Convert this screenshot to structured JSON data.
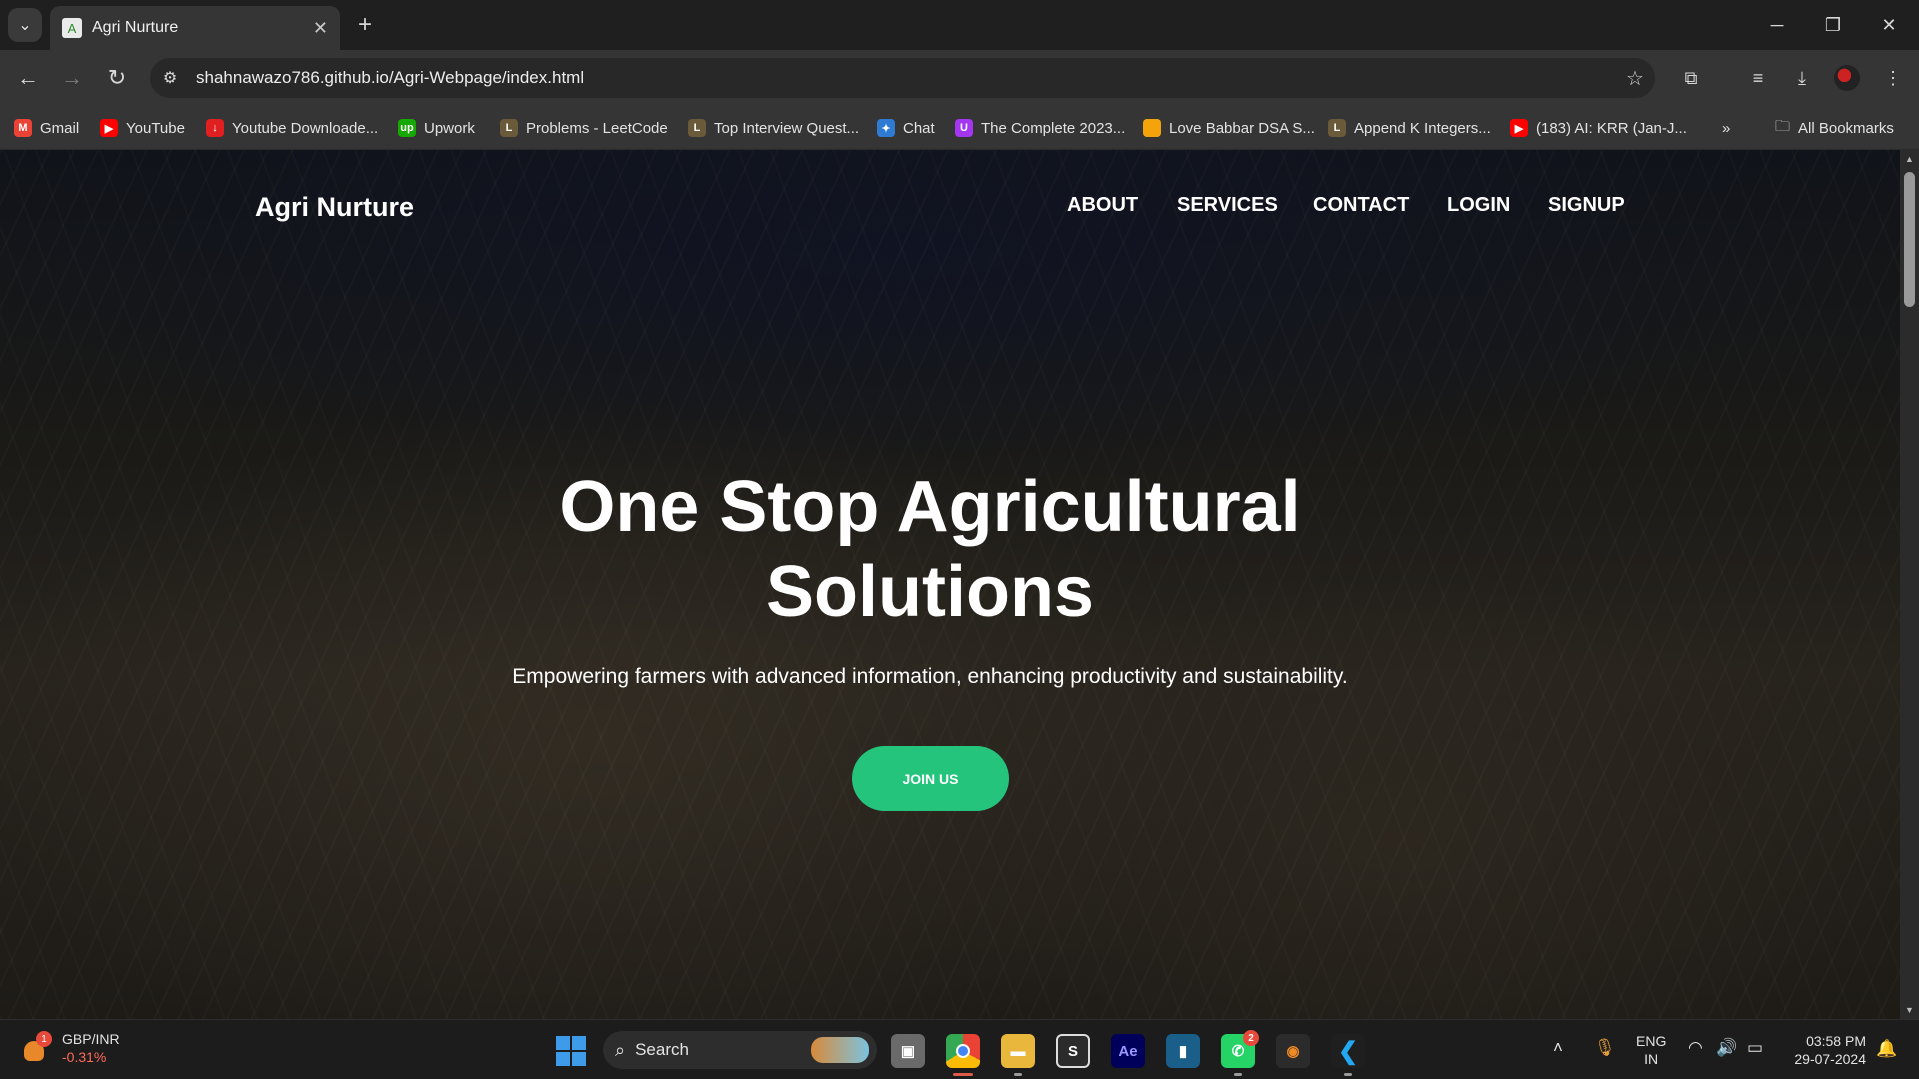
{
  "browser": {
    "tab_title": "Agri Nurture",
    "tab_favicon": "A",
    "url": "shahnawazo786.github.io/Agri-Webpage/index.html",
    "bookmarks": [
      {
        "label": "Gmail",
        "icon": "M",
        "color": "#ea4335"
      },
      {
        "label": "YouTube",
        "icon": "▶",
        "color": "#ff0000"
      },
      {
        "label": "Youtube Downloade...",
        "icon": "↓",
        "color": "#e02020"
      },
      {
        "label": "Upwork",
        "icon": "up",
        "color": "#14a800"
      },
      {
        "label": "Problems - LeetCode",
        "icon": "L",
        "color": "#6b5a3a"
      },
      {
        "label": "Top Interview Quest...",
        "icon": "L",
        "color": "#6b5a3a"
      },
      {
        "label": "Chat",
        "icon": "✦",
        "color": "#2f7bd3"
      },
      {
        "label": "The Complete 2023...",
        "icon": "U",
        "color": "#a435f0"
      },
      {
        "label": "Love Babbar DSA S...",
        "icon": "",
        "color": "#f5a30a"
      },
      {
        "label": "Append K Integers...",
        "icon": "L",
        "color": "#6b5a3a"
      },
      {
        "label": "(183) AI: KRR (Jan-J...",
        "icon": "▶",
        "color": "#ff0000"
      }
    ],
    "bookmarks_overflow": "»",
    "all_bookmarks": "All Bookmarks"
  },
  "site": {
    "logo": "Agri Nurture",
    "nav": [
      "ABOUT",
      "SERVICES",
      "CONTACT",
      "LOGIN",
      "SIGNUP"
    ],
    "hero_title": "One Stop Agricultural Solutions",
    "hero_subtitle": "Empowering farmers with advanced information, enhancing productivity and sustainability.",
    "cta_label": "JOIN US",
    "cta_color": "#25c47d"
  },
  "taskbar": {
    "widget_badge": "1",
    "widget_title": "GBP/INR",
    "widget_value": "-0.31%",
    "search_label": "Search",
    "whatsapp_badge": "2",
    "ae_label": "Ae",
    "lang_top": "ENG",
    "lang_bottom": "IN",
    "time": "03:58 PM",
    "date": "29-07-2024"
  }
}
